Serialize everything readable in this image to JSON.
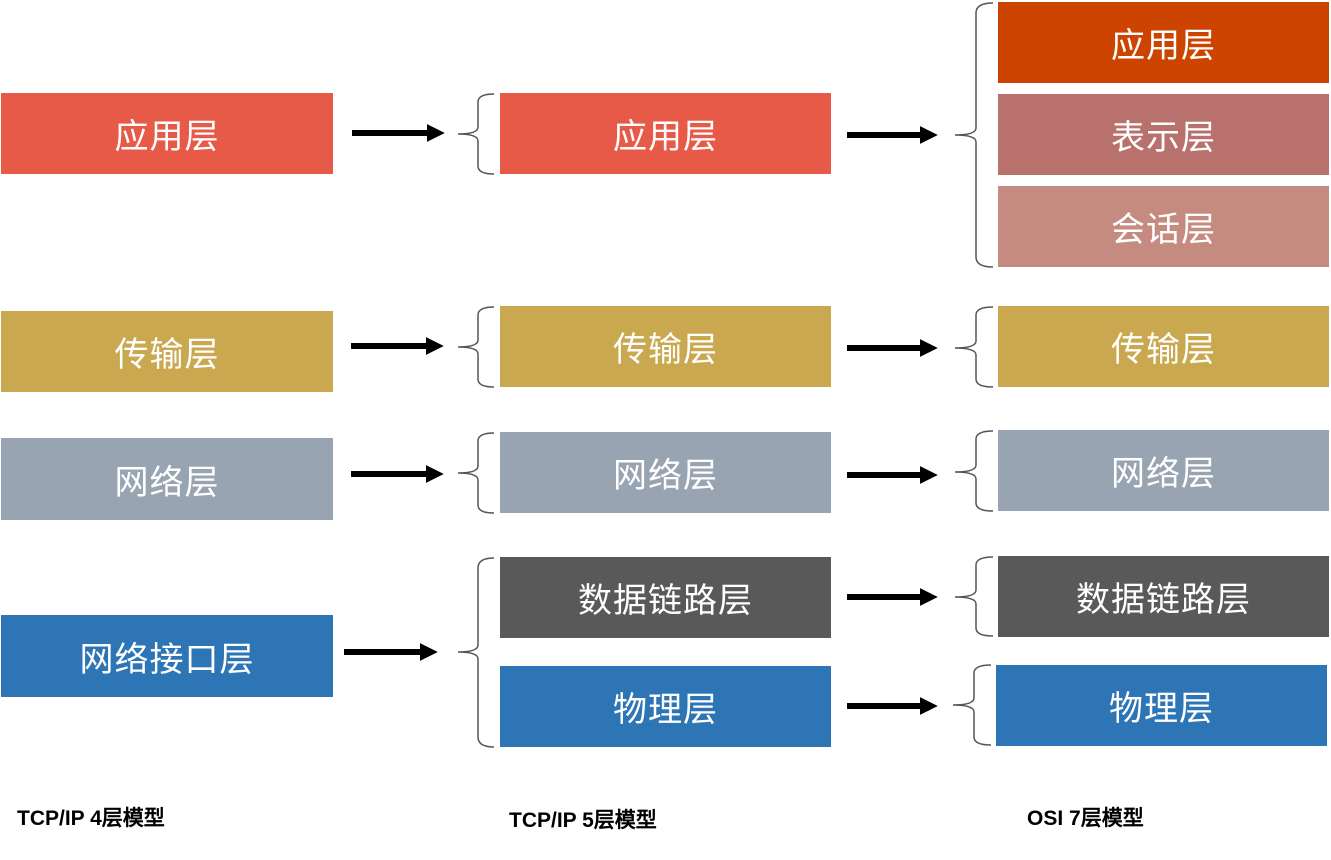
{
  "colors": {
    "application": "#E85A48",
    "osi_application": "#CC4400",
    "presentation": "#B8716D",
    "session": "#C58B80",
    "transport": "#C9A84F",
    "network": "#98A4B2",
    "datalink": "#595959",
    "physical": "#2E75B5",
    "network_interface": "#2E75B5",
    "text": "#FFFFFF"
  },
  "col4": {
    "caption": "TCP/IP 4层模型",
    "application": "应用层",
    "transport": "传输层",
    "network": "网络层",
    "network_interface": "网络接口层"
  },
  "col5": {
    "caption": "TCP/IP 5层模型",
    "application": "应用层",
    "transport": "传输层",
    "network": "网络层",
    "datalink": "数据链路层",
    "physical": "物理层"
  },
  "col7": {
    "caption": "OSI 7层模型",
    "application": "应用层",
    "presentation": "表示层",
    "session": "会话层",
    "transport": "传输层",
    "network": "网络层",
    "datalink": "数据链路层",
    "physical": "物理层"
  }
}
